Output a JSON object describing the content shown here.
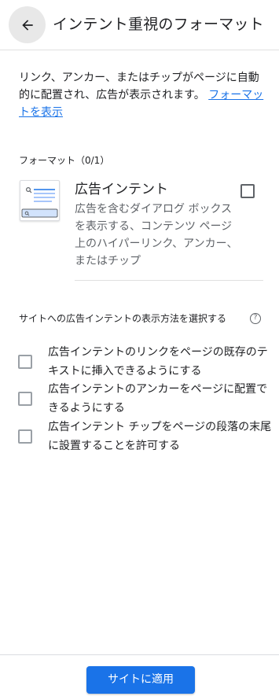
{
  "header": {
    "back_icon": "arrow-left-icon",
    "title": "インテント重視のフォーマット"
  },
  "description": {
    "text": "リンク、アンカー、またはチップがページに自動的に配置され、広告が表示されます。",
    "link_label": "フォーマットを表示"
  },
  "formats": {
    "label": "フォーマット（0/1）",
    "items": [
      {
        "title": "広告インテント",
        "description": "広告を含むダイアログ ボックスを表示する、コンテンツ ページ上のハイパーリンク、アンカー、またはチップ",
        "checked": false,
        "thumb_icon": "ad-intent-preview-icon"
      }
    ]
  },
  "display_options": {
    "label": "サイトへの広告インテントの表示方法を選択する",
    "help_icon": "help-circle-icon",
    "help_glyph": "?",
    "options": [
      {
        "label": "広告インテントのリンクをページの既存のテキストに挿入できるようにする",
        "checked": false
      },
      {
        "label": "広告インテントのアンカーをページに配置できるようにする",
        "checked": false
      },
      {
        "label": "広告インテント チップをページの段落の末尾に設置することを許可する",
        "checked": false
      }
    ]
  },
  "footer": {
    "apply_label": "サイトに適用",
    "apply_color": "#1a73e8"
  }
}
